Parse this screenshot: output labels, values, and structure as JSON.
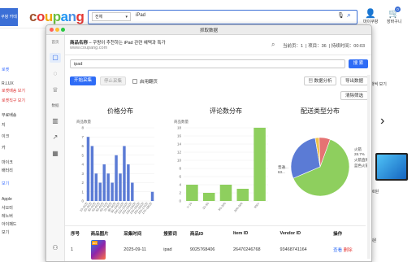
{
  "background": {
    "sidebar_tab": "쿠팡 카테고리",
    "logo_letters": [
      {
        "ch": "c",
        "color": "#a0522d"
      },
      {
        "ch": "o",
        "color": "#e53935"
      },
      {
        "ch": "u",
        "color": "#f0a500"
      },
      {
        "ch": "p",
        "color": "#6abf40"
      },
      {
        "ch": "a",
        "color": "#2196f3"
      },
      {
        "ch": "n",
        "color": "#4a90e2"
      },
      {
        "ch": "g",
        "color": "#e53935"
      }
    ],
    "search_category": "전체",
    "search_query": "iPad",
    "header_icons": [
      {
        "name": "mypage",
        "label": "마이쿠팡"
      },
      {
        "name": "cart",
        "label": "장바구니",
        "badge": "0"
      }
    ],
    "left_links": [
      {
        "text": "로켓",
        "style": "blue"
      },
      {
        "text": "R.LUX",
        "style": ""
      },
      {
        "text": "로켓배송 보기",
        "style": "red"
      },
      {
        "text": "로켓직구 보기",
        "style": "red"
      },
      {
        "text": "무료배송",
        "style": ""
      },
      {
        "text": "지",
        "style": ""
      },
      {
        "text": "이크",
        "style": ""
      },
      {
        "text": "카",
        "style": ""
      },
      {
        "text": "마이크",
        "style": ""
      },
      {
        "text": "배터리",
        "style": ""
      },
      {
        "text": "보기",
        "style": "blue"
      },
      {
        "text": "Apple",
        "style": ""
      },
      {
        "text": "샤오미",
        "style": ""
      },
      {
        "text": "레노버",
        "style": ""
      },
      {
        "text": "아이패드",
        "style": ""
      },
      {
        "text": "보기",
        "style": ""
      }
    ],
    "right_sort_label": "개씩 보기",
    "right_price_fragment": "00원",
    "right_price_fragment2": "8원"
  },
  "dialog": {
    "title": "抓取数据",
    "sidebar": {
      "section1": "首页",
      "section2": "数据"
    },
    "product_title_prefix": "商品名称",
    "product_title": "– 쿠팡이 추천하는 iPad 관련 혜택과 특가",
    "product_url": "www.coupang.com",
    "stats": {
      "page_label": "当前页：",
      "page_value": "1",
      "items_label": "项目：",
      "items_value": "36",
      "time_label": "持续时间：",
      "time_value": "00:03"
    },
    "keyword": "ipad",
    "search_button": "搜 索",
    "start_button": "开始采集",
    "stop_button": "停止采集",
    "paging_label": "启用翻页",
    "analysis_button": "数据分析",
    "export_button": "导出数据",
    "clear_button": "清除筛选",
    "table": {
      "headers": [
        "序号",
        "商品图片",
        "采集时间",
        "搜索词",
        "商品ID",
        "Item ID",
        "Vendor ID",
        "",
        "操作"
      ],
      "rows": [
        {
          "no": "1",
          "badge": "AD",
          "time": "2025-09-11",
          "kw": "ipad",
          "pid": "9025768406",
          "iid": "26470246768",
          "vid": "93468741164",
          "action_view": "查看",
          "action_del": "删除"
        }
      ]
    }
  },
  "chart_data": [
    {
      "type": "bar",
      "title": "价格分布",
      "ylabel": "商品数量",
      "ylim": [
        0,
        8
      ],
      "yticks": [
        0,
        1,
        2,
        3,
        4,
        5,
        6,
        7,
        8
      ],
      "color": "#5b7bd5",
      "categories": [
        "10–20万",
        "20–30万",
        "30–40万",
        "40–50万",
        "50–60万",
        "60–70万",
        "70–80万",
        "80–90万",
        "90–100万",
        "100–110万",
        "110–120万",
        "120–130万",
        "130–140万",
        "140–150万",
        "150–160万",
        "160–170万",
        "170–180万"
      ],
      "values": [
        7,
        6,
        3,
        2,
        4,
        3,
        2,
        5,
        3,
        6,
        4,
        2,
        0,
        0,
        0,
        0,
        1
      ]
    },
    {
      "type": "bar",
      "title": "评论数分布",
      "ylabel": "商品数量",
      "ylim": [
        0,
        18
      ],
      "yticks": [
        0,
        2,
        4,
        6,
        8,
        10,
        12,
        14,
        16,
        18
      ],
      "color": "#8ecf5e",
      "categories": [
        "1–10",
        "10–50",
        "50–200",
        "200–500",
        "500+"
      ],
      "values": [
        4,
        2,
        4,
        3,
        18
      ]
    },
    {
      "type": "pie",
      "title": "配送类型分布",
      "slices": [
        {
          "label": "普通配送",
          "value": 63,
          "color": "#8ecf5e"
        },
        {
          "label": "火箭",
          "value": 28.7,
          "color": "#5b7bd5"
        },
        {
          "label": "火箭直购",
          "value": 2.2,
          "color": "#f0c14b"
        },
        {
          "label": "蓝色火箭",
          "value": 6.1,
          "color": "#e57373"
        }
      ],
      "visible_labels": [
        {
          "text": "普通...",
          "sub": "63..."
        },
        {
          "text": "火箭",
          "sub": "28.7%"
        },
        {
          "text": "火箭直购",
          "sub": ""
        },
        {
          "text": "蓝色火箭",
          "sub": ""
        }
      ]
    }
  ]
}
